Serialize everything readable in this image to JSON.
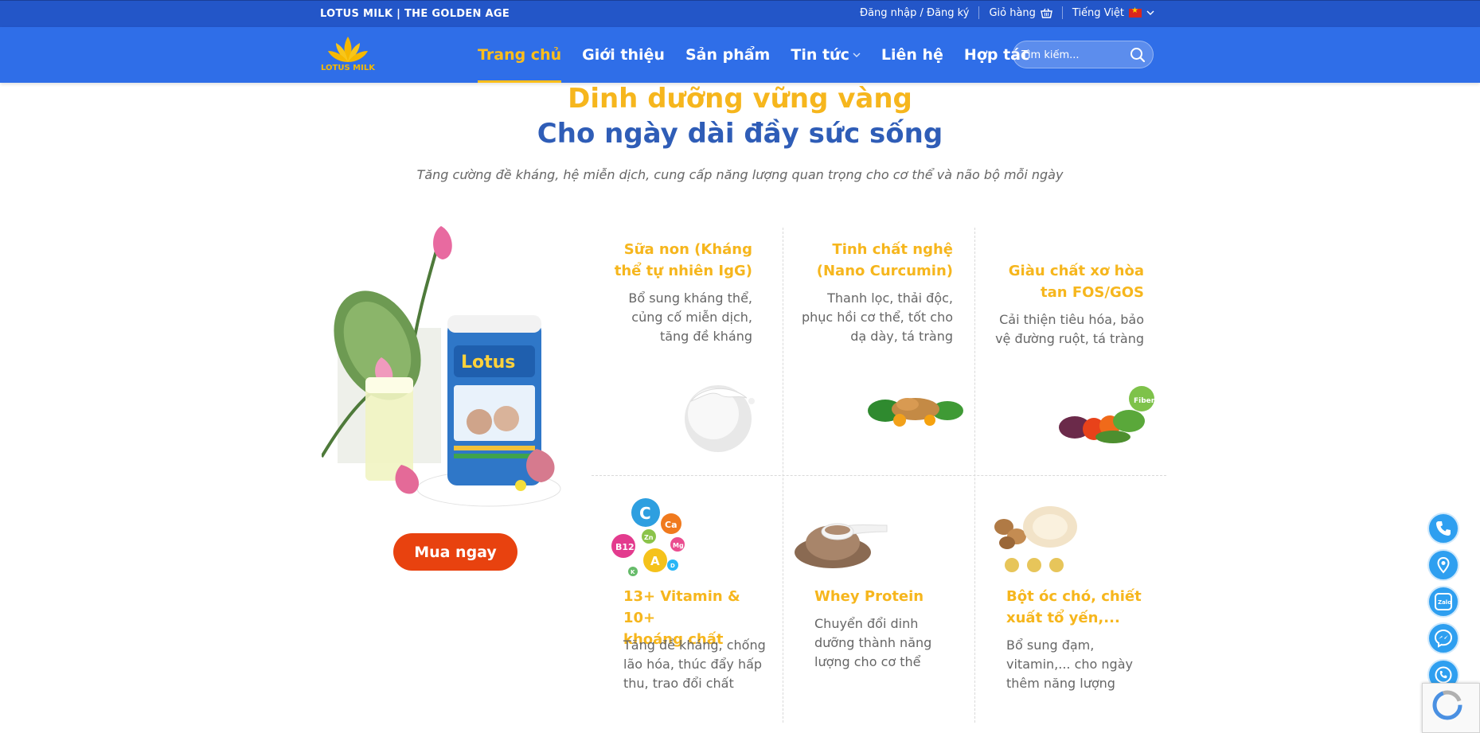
{
  "topbar": {
    "brand": "LOTUS MILK | THE GOLDEN AGE",
    "login": "Đăng nhập / Đăng ký",
    "cart": "Giỏ hàng",
    "language": "Tiếng Việt"
  },
  "nav": {
    "logo_text": "LOTUS MILK",
    "items": [
      {
        "label": "Trang chủ"
      },
      {
        "label": "Giới thiệu"
      },
      {
        "label": "Sản phẩm"
      },
      {
        "label": "Tin tức"
      },
      {
        "label": "Liên hệ"
      },
      {
        "label": "Hợp tác"
      }
    ],
    "search_placeholder": "Tìm kiếm..."
  },
  "hero": {
    "title_line1": "Dinh dưỡng vững vàng",
    "title_line2": "Cho ngày dài đầy sức sống",
    "subtitle": "Tăng cường đề kháng, hệ miễn dịch, cung cấp năng lượng quan trọng cho cơ thể và não bộ mỗi ngày",
    "buy_button": "Mua ngay",
    "product_can_label": "Lotus"
  },
  "features": [
    {
      "title_l1": "Sữa non (Kháng",
      "title_l2": "thể tự nhiên IgG)",
      "desc_l1": "Bổ sung kháng thể,",
      "desc_l2": "củng cố miễn dịch,",
      "desc_l3": "tăng đề kháng"
    },
    {
      "title_l1": "Tinh chất nghệ",
      "title_l2": "(Nano Curcumin)",
      "desc_l1": "Thanh lọc, thải độc,",
      "desc_l2": "phục hồi cơ thể, tốt cho",
      "desc_l3": "dạ dày, tá tràng"
    },
    {
      "title_l1": "Giàu chất xơ hòa",
      "title_l2": "tan FOS/GOS",
      "desc_l1": "Cải thiện tiêu hóa, bảo",
      "desc_l2": "vệ đường ruột, tá tràng",
      "desc_l3": ""
    },
    {
      "title_l1": "13+ Vitamin & 10+",
      "title_l2": "khoáng chất",
      "desc_l1": "Tăng đề kháng, chống",
      "desc_l2": "lão hóa, thúc đẩy hấp",
      "desc_l3": "thu, trao đổi chất"
    },
    {
      "title_l1": "Whey Protein",
      "title_l2": "",
      "desc_l1": "Chuyển đổi dinh",
      "desc_l2": "dưỡng thành năng",
      "desc_l3": "lượng cho cơ thể"
    },
    {
      "title_l1": "Bột óc chó, chiết",
      "title_l2": "xuất tổ yến,...",
      "desc_l1": "Bổ sung đạm,",
      "desc_l2": "vitamin,... cho ngày",
      "desc_l3": "thêm năng lượng"
    }
  ],
  "vitamin_labels": [
    "C",
    "Ca",
    "B12",
    "A",
    "Zn",
    "Mg",
    "D",
    "K"
  ],
  "fiber_badge": "Fiber",
  "zalo_label": "Zalo",
  "colors": {
    "topbar": "#2356c8",
    "navbar": "#2f6ee8",
    "accent_yellow": "#f6b61d",
    "heading_blue": "#2f5db7",
    "buy_button": "#e8420f",
    "float_button": "#2e9ff0"
  }
}
